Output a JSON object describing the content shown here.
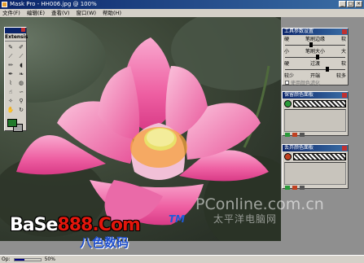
{
  "window": {
    "title": "Mask Pro - HH006.jpg @ 100%",
    "buttons": [
      "_",
      "□",
      "×"
    ]
  },
  "menu": [
    "文件(F)",
    "编辑(E)",
    "查看(V)",
    "窗口(W)",
    "帮助(H)"
  ],
  "toolbox": {
    "title": "Extensis",
    "tools": [
      "keep-pen-icon",
      "drop-pen-icon",
      "keep-eyedropper-icon",
      "drop-eyedropper-icon",
      "brush-icon",
      "bucket-icon",
      "magic-pen-icon",
      "magic-brush-icon",
      "chisel-icon",
      "blur-icon",
      "smudge-icon",
      "lasso-icon",
      "magic-wand-icon",
      "zoom-icon",
      "hand-icon",
      "rotate-icon"
    ],
    "foreground_color": "#217a2b",
    "background_color": "#a0a0a0"
  },
  "tool_options": {
    "title": "工具参数设置",
    "rows": [
      {
        "left": "硬",
        "center": "笔刷边缘",
        "right": "软"
      },
      {
        "left": "小",
        "center": "笔刷大小",
        "right": "大"
      },
      {
        "left": "硬",
        "center": "过渡",
        "right": "软"
      },
      {
        "left": "较少",
        "center": "开端",
        "right": "较多"
      }
    ],
    "checkbox_label": "使用颜色滤化"
  },
  "keep_colors": {
    "title": "保留颜色面板"
  },
  "drop_colors": {
    "title": "丢弃颜色面板"
  },
  "status": {
    "left": "Op:",
    "zoom": "50%",
    "progress": 0.4
  },
  "watermark": {
    "logo_a": "BaSe",
    "logo_b": "888",
    "logo_c": ".Com",
    "logo_cn": "八色数码",
    "tm": "TM",
    "pconline": "PConline.com.cn",
    "pconline_cn": "太平洋电脑网"
  }
}
